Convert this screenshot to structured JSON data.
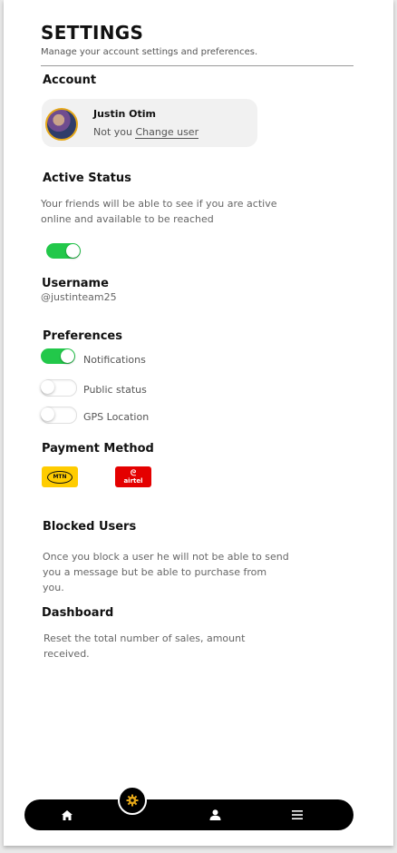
{
  "header": {
    "title": "SETTINGS",
    "subtitle": "Manage your account settings and preferences."
  },
  "account": {
    "heading": "Account",
    "name": "Justin Otim",
    "not_you_label": "Not you",
    "change_user_label": "Change user"
  },
  "active_status": {
    "heading": "Active Status",
    "description_line1": "Your friends will be able to see if you are active",
    "description_line2": "online and available to be reached",
    "enabled": true
  },
  "username": {
    "heading": "Username",
    "value": "@justinteam25"
  },
  "preferences": {
    "heading": "Preferences",
    "items": [
      {
        "label": "Notifications",
        "enabled": true
      },
      {
        "label": "Public status",
        "enabled": false
      },
      {
        "label": "GPS Location",
        "enabled": false
      }
    ]
  },
  "payment": {
    "heading": "Payment Method",
    "methods": [
      {
        "brand": "MTN",
        "color": "#ffcc00"
      },
      {
        "brand": "airtel",
        "color": "#e40000"
      }
    ]
  },
  "blocked": {
    "heading": "Blocked Users",
    "line1": "Once you block a user he will not be able to send",
    "line2": "you a message but be able to purchase from",
    "line3": "you."
  },
  "dashboard": {
    "heading": "Dashboard",
    "line1": "Reset the total number of sales, amount",
    "line2": "received."
  },
  "nav": {
    "items": [
      "home-icon",
      "gear-icon",
      "user-icon",
      "menu-icon"
    ],
    "active": "gear-icon",
    "accent_color": "#e6a818"
  },
  "colors": {
    "toggle_on": "#22c84a"
  }
}
